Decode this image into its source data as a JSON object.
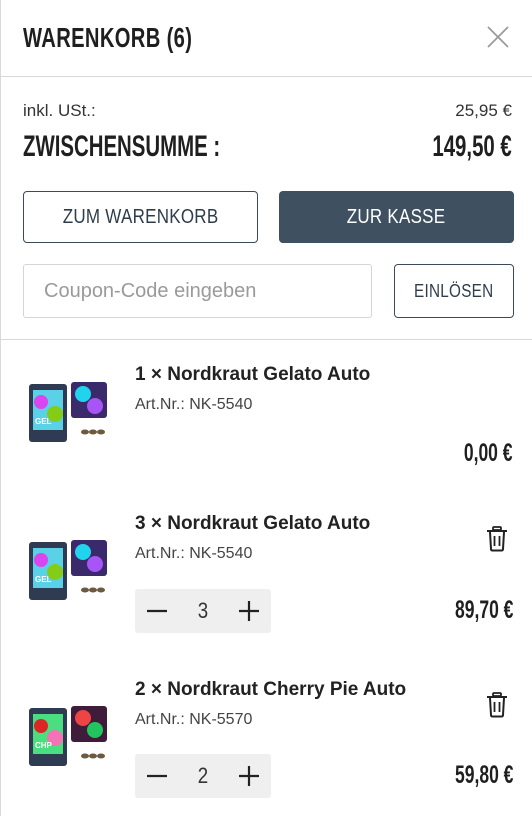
{
  "header": {
    "title": "WARENKORB (6)"
  },
  "totals": {
    "tax_label": "inkl. USt.:",
    "tax_value": "25,95 €",
    "subtotal_label": "ZWISCHENSUMME :",
    "subtotal_value": "149,50 €"
  },
  "actions": {
    "cart_label": "ZUM WARENKORB",
    "checkout_label": "ZUR KASSE"
  },
  "coupon": {
    "placeholder": "Coupon-Code eingeben",
    "value": "",
    "redeem_label": "EINLÖSEN"
  },
  "items": [
    {
      "name": "1 × Nordkraut Gelato Auto",
      "sku": "Art.Nr.: NK-5540",
      "price": "0,00 €",
      "quantity": null,
      "removable": false,
      "image": "gelato-auto-pack"
    },
    {
      "name": "3 × Nordkraut Gelato Auto",
      "sku": "Art.Nr.: NK-5540",
      "price": "89,70 €",
      "quantity": "3",
      "removable": true,
      "image": "gelato-auto-pack"
    },
    {
      "name": "2 × Nordkraut Cherry Pie Auto",
      "sku": "Art.Nr.: NK-5570",
      "price": "59,80 €",
      "quantity": "2",
      "removable": true,
      "image": "cherry-pie-auto-pack"
    }
  ],
  "colors": {
    "primary_dark": "#3f5060",
    "border": "#d9d9d9",
    "stepper_bg": "#efefef"
  }
}
